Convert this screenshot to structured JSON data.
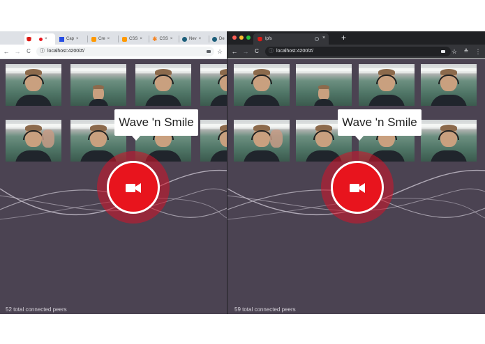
{
  "left_window": {
    "tabs": [
      {
        "label": "",
        "icon": "angular-icon"
      },
      {
        "label": "Cap",
        "icon": "css3-icon"
      },
      {
        "label": "Cre",
        "icon": "aws-icon"
      },
      {
        "label": "CSS",
        "icon": "aws-icon"
      },
      {
        "label": "CSS",
        "icon": "asterisk-icon"
      },
      {
        "label": "Nev",
        "icon": "globe-icon"
      },
      {
        "label": "De",
        "icon": "globe-icon"
      }
    ],
    "url": "localhost:4200/#/",
    "tooltip": "Wave 'n Smile",
    "status": "52 total connected peers"
  },
  "right_window": {
    "tab_title": "Ipfs",
    "new_tab": "+",
    "url": "localhost:4200/#/",
    "tooltip": "Wave 'n Smile",
    "status": "59 total connected peers"
  },
  "icons": {
    "close": "×",
    "back": "←",
    "forward": "→",
    "reload": "C",
    "info": "ⓘ",
    "star": "☆",
    "menu": "⋮"
  },
  "colors": {
    "page_bg": "#4b4352",
    "record_red": "#e8141d",
    "halo_red": "#d61228"
  }
}
